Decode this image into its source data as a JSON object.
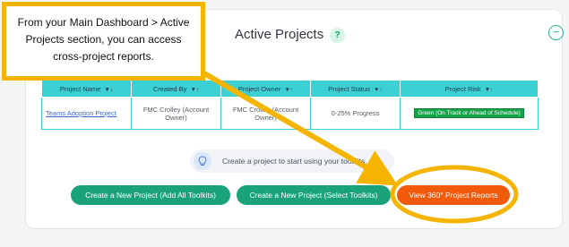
{
  "card": {
    "title": "Active Projects",
    "help_icon": "question-icon",
    "collapse_icon": "minus-circle-icon"
  },
  "table": {
    "headers": [
      {
        "label": "Project Name",
        "sort": "▼↓"
      },
      {
        "label": "Created By",
        "sort": "▼↑"
      },
      {
        "label": "Project Owner",
        "sort": "▼↑"
      },
      {
        "label": "Project Status",
        "sort": "▼↑"
      },
      {
        "label": "Project Risk",
        "sort": "▼↑"
      }
    ],
    "rows": [
      {
        "name": "Teams Adoption Project",
        "created_by": "FMC Crolley (Account Owner)",
        "owner": "FMC Crolley (Account Owner)",
        "status": "0-25% Progress",
        "risk": "Green (On Track or Ahead of Schedule)"
      }
    ]
  },
  "hint": {
    "icon": "lightbulb-icon",
    "text": "Create a project to start using your toolkits."
  },
  "buttons": {
    "add_all": "Create a New Project (Add All Toolkits)",
    "select": "Create a New Project (Select Toolkits)",
    "reports": "View 360° Project Reports"
  },
  "callout": {
    "text": "From your Main Dashboard > Active Projects section, you can access cross-project reports."
  },
  "colors": {
    "callout_border": "#f4b400",
    "table_header": "#3ccfd4",
    "green_button": "#1aa37a",
    "orange_button": "#f05a0a",
    "risk_green": "#16a34a"
  }
}
